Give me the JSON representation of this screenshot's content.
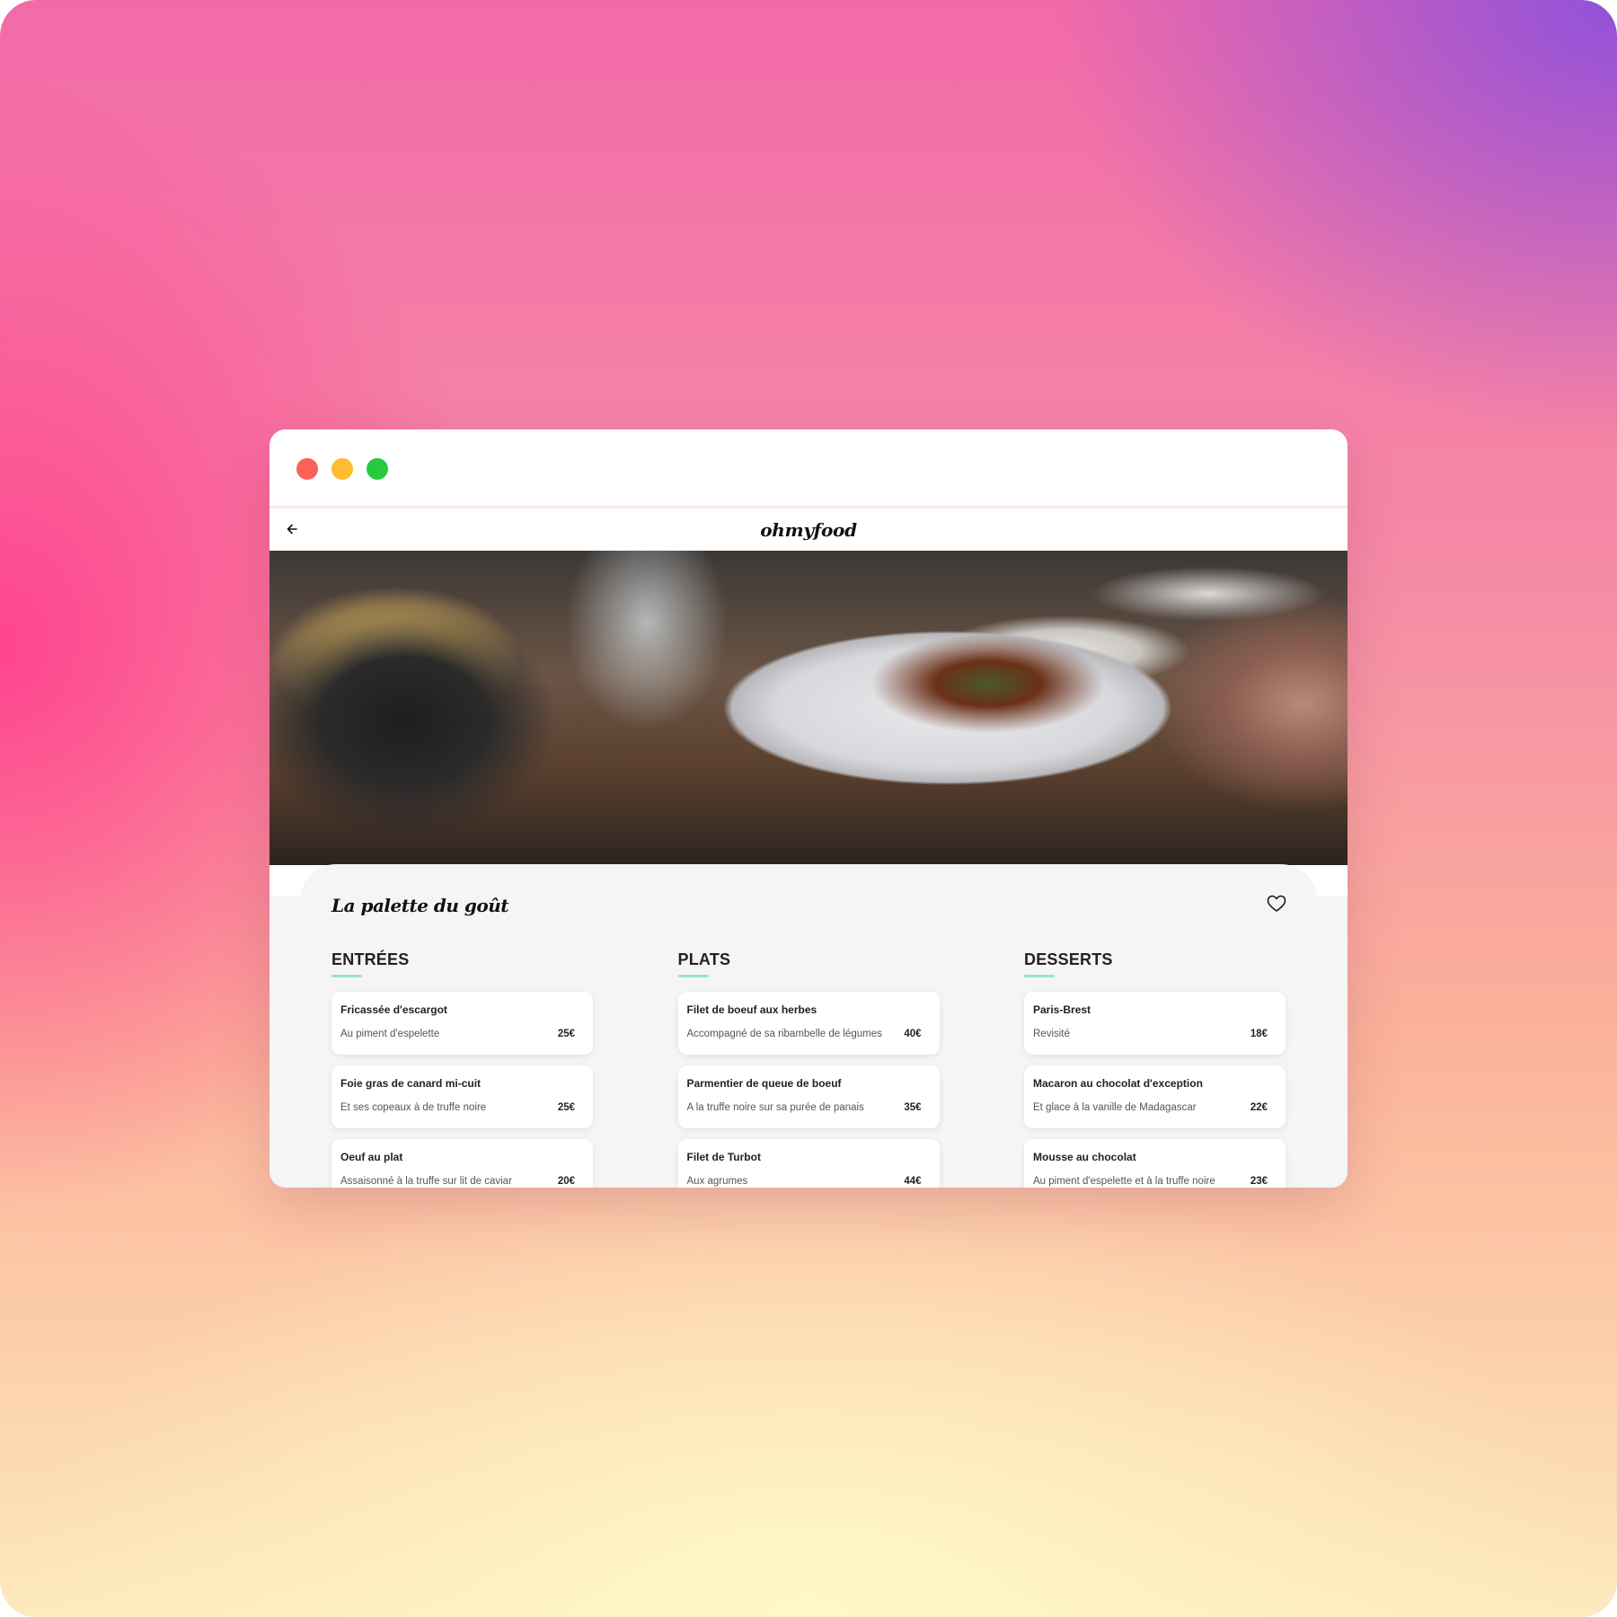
{
  "colors": {
    "close": "#fe5f57",
    "minimize": "#febc2e",
    "maximize": "#28c840",
    "accent": "#99e2d0"
  },
  "app": {
    "logo": "ohmyfood",
    "back_icon": "arrow-left-icon"
  },
  "restaurant": {
    "name": "La palette du goût",
    "favorite_icon": "heart-outline-icon"
  },
  "menu": [
    {
      "title": "ENTRÉES",
      "items": [
        {
          "name": "Fricassée d'escargot",
          "description": "Au piment d'espelette",
          "price": "25€"
        },
        {
          "name": "Foie gras de canard mi-cuit",
          "description": "Et ses copeaux à de truffe noire",
          "price": "25€"
        },
        {
          "name": "Oeuf au plat",
          "description": "Assaisonné à la truffe sur lit de caviar",
          "price": "20€"
        }
      ]
    },
    {
      "title": "PLATS",
      "items": [
        {
          "name": "Filet de boeuf aux herbes",
          "description": "Accompagné de sa ribambelle de légumes",
          "price": "40€"
        },
        {
          "name": "Parmentier de queue de boeuf",
          "description": "A la truffe noire sur sa purée de panais",
          "price": "35€"
        },
        {
          "name": "Filet de Turbot",
          "description": "Aux agrumes",
          "price": "44€"
        }
      ]
    },
    {
      "title": "DESSERTS",
      "items": [
        {
          "name": "Paris-Brest",
          "description": "Revisité",
          "price": "18€"
        },
        {
          "name": "Macaron au chocolat d'exception",
          "description": "Et glace à la vanille de Madagascar",
          "price": "22€"
        },
        {
          "name": "Mousse au chocolat",
          "description": "Au piment d'espelette et à la truffe noire",
          "price": "23€"
        }
      ]
    }
  ]
}
